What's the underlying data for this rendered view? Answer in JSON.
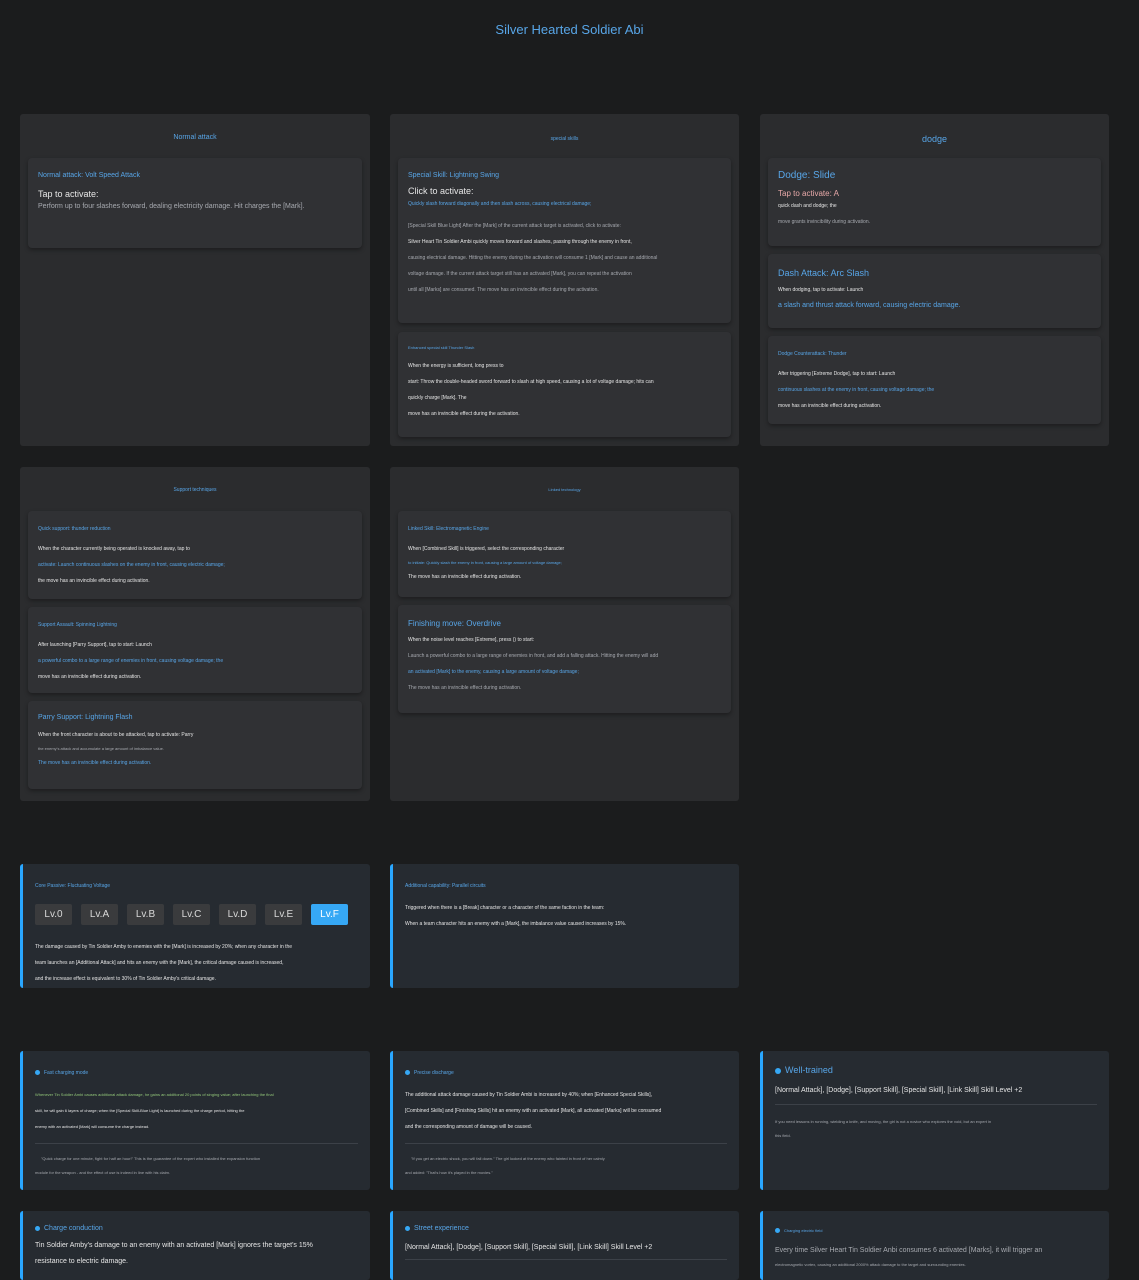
{
  "page_title": "Silver Hearted Soldier Abi",
  "panels": {
    "normal": {
      "title": "Normal attack",
      "card1": {
        "title": "Normal attack: Volt Speed Attack",
        "l1": "Tap to activate:",
        "l2": "Perform up to four slashes forward, dealing electricity damage. Hit charges the [Mark]."
      }
    },
    "special": {
      "title": "special skills",
      "card1": {
        "title": "Special Skill: Lightning Swing",
        "l1": "Click to activate:",
        "l2": "Quickly slash forward diagonally and then slash across, causing electrical damage;",
        "l3": "[Special Skill Blue Light] After the [Mark] of the current attack target is activated, click to activate:",
        "l4": "Silver Heart Tin Soldier Ambi quickly moves forward and slashes, passing through the enemy in front,",
        "l5": "causing electrical damage. Hitting the enemy during the activation will consume 1 [Mark] and cause an additional",
        "l6": "voltage damage. If the current attack target still has an activated [Mark], you can repeat the activation",
        "l7": "until all [Marks] are consumed. The move has an invincible effect during the activation."
      },
      "card2": {
        "title": "Enhanced special skill Thunder Slash",
        "l1": "When the energy is sufficient, long press to",
        "l2": "start: Throw the double-headed sword forward to slash at high speed, causing a lot of voltage damage; hits can",
        "l3": "quickly charge [Mark]. The",
        "l4": "move has an invincible effect during the activation."
      }
    },
    "dodge": {
      "title": "dodge",
      "card1": {
        "title": "Dodge: Slide",
        "l1": "Tap to activate: A",
        "l2": "quick dash and dodge; the",
        "l3": "move grants invincibility during activation."
      },
      "card2": {
        "title": "Dash Attack: Arc Slash",
        "l1": "When dodging, tap to activate: Launch",
        "l2": "a slash and thrust attack forward, causing electric damage."
      },
      "card3": {
        "title": "Dodge Counterattack: Thunder",
        "l1": "After triggering [Extreme Dodge], tap to start: Launch",
        "l2": "continuous slashes at the enemy in front, causing voltage damage; the",
        "l3": "move has an invincible effect during activation."
      }
    },
    "support": {
      "title": "Support techniques",
      "card1": {
        "title": "Quick support: thunder reduction",
        "l1": "When the character currently being operated is knocked away, tap to",
        "l2": "activate: Launch continuous slashes on the enemy in front, causing electric damage;",
        "l3": "the move has an invincible effect during activation."
      },
      "card2": {
        "title": "Support Assault: Spinning Lightning",
        "l1": "After launching [Parry Support], tap to start: Launch",
        "l2": "a powerful combo to a large range of enemies in front, causing voltage damage; the",
        "l3": "move has an invincible effect during activation."
      },
      "card3": {
        "title": "Parry Support: Lightning Flash",
        "l1": "When the front character is about to be attacked, tap to activate: Parry",
        "l2": "the enemy's attack and accumulate a large amount of imbalance value.",
        "l3": "The move has an invincible effect during activation."
      }
    },
    "linked": {
      "title": "Linked technology",
      "card1": {
        "title": "Linked Skill: Electromagnetic Engine",
        "l1": "When [Combined Skill] is triggered, select the corresponding character",
        "l2": "to initiate: Quickly slash the enemy in front, causing a large amount of voltage damage;",
        "l3": "The move has an invincible effect during activation."
      },
      "card2": {
        "title": "Finishing move: Overdrive",
        "l1": "When the noise level reaches [Extreme], press () to start:",
        "l2": "Launch a powerful combo to a large range of enemies in front, and add a falling attack. Hitting the enemy will add",
        "l3": "an activated [Mark] to the enemy, causing a large amount of voltage damage;",
        "l4": "The move has an invincible effect during activation."
      }
    }
  },
  "core_passive": {
    "title": "Core Passive: Fluctuating Voltage",
    "levels": [
      "Lv.0",
      "Lv.A",
      "Lv.B",
      "Lv.C",
      "Lv.D",
      "Lv.E",
      "Lv.F"
    ],
    "active_level": "Lv.F",
    "l1": "The damage caused by Tin Soldier Amby to enemies with the [Mark] is increased by 20%; when any character in the",
    "l2": "team launches an [Additional Attack] and hits an enemy with the [Mark], the critical damage caused is increased,",
    "l3": "and the increase effect is equivalent to 30% of Tin Soldier Amby's critical damage."
  },
  "additional": {
    "title": "Additional capability: Parallel circuits",
    "l1": "Triggered when there is a [Break] character or a character of the same faction in the team:",
    "l2": "When a team character hits an enemy with a [Mark], the imbalance value caused increases by 15%."
  },
  "talents": {
    "fast": {
      "title": "Fast charging mode",
      "l1": "Whenever Tin Soldier Ambi causes additional attack damage, he gains an additional 20 points of singing value; after launching the final",
      "l2": "skill, he will gain 6 layers of charge; when the [Special Skill-Blue Light] is launched during the charge period, hitting the",
      "l3": "enemy with an activated [Mark] will consume the charge instead.",
      "q1": "\"Quick charge for one minute, fight for half an hour!\" This is the guarantee of the expert who installed the expansion function",
      "q2": "module for the weapon - and the effect of use is indeed in line with his claim."
    },
    "precise": {
      "title": "Precise discharge",
      "l1": "The additional attack damage caused by Tin Soldier Ambi is increased by 40%; when [Enhanced Special Skills],",
      "l2": "[Combined Skills] and [Finishing Skills] hit an enemy with an activated [Mark], all activated [Marks] will be consumed",
      "l3": "and the corresponding amount of damage will be caused.",
      "q1": "\"If you get an electric shock, you will fall down.\" The girl looked at the enemy who fainted in front of her calmly",
      "q2": "and added: \"That's how it's played in the movies.\""
    },
    "welltrained": {
      "title": "Well-trained",
      "l1": "[Normal Attack], [Dodge], [Support Skill], [Special Skill], [Link Skill] Skill Level +2",
      "q1": "If you need lessons in running, wielding a knife, and moving, the girl is not a novice who explores the void, but an expert in",
      "q2": "this field."
    },
    "charge": {
      "title": "Charge conduction",
      "l1": "Tin Soldier Amby's damage to an enemy with an activated [Mark] ignores the target's 15%",
      "l2": "resistance to electric damage."
    },
    "street": {
      "title": "Street experience",
      "l1": "[Normal Attack], [Dodge], [Support Skill], [Special Skill], [Link Skill] Skill Level +2"
    },
    "field": {
      "title": "Charging electric field",
      "l1": "Every time Silver Heart Tin Soldier Anbi consumes 6 activated [Marks], it will trigger an",
      "l2": "electromagnetic vortex, causing an additional 2000% attack damage to the target and surrounding enemies."
    }
  },
  "colors": {
    "background": "#1b1c1d",
    "panel": "#2b2c2e",
    "card": "#303134",
    "accent": "#58a6e8",
    "active_level": "#36a8f5"
  }
}
